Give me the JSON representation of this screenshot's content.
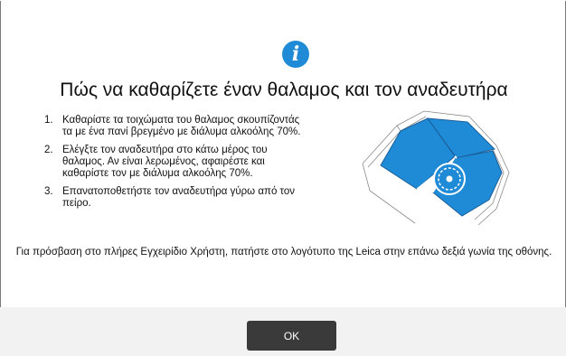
{
  "dialog": {
    "icon": "info-icon",
    "title": "Πώς να καθαρίζετε έναν θαλαμος και τον αναδευτήρα",
    "steps": [
      {
        "number": "1.",
        "text": "Καθαρίστε τα τοιχώματα του θαλαμος σκουπίζοντάς τα με ένα πανί βρεγμένο με διάλυμα αλκοόλης 70%."
      },
      {
        "number": "2.",
        "text": "Ελέγξτε τον αναδευτήρα στο κάτω μέρος του θαλαμος. Αν είναι λερωμένος, αφαιρέστε και καθαρίστε τον με διάλυμα αλκοόλης 70%."
      },
      {
        "number": "3.",
        "text": "Επανατοποθετήστε τον αναδευτήρα γύρω από τον πείρο."
      }
    ],
    "illustration": "chamber-stirrer-diagram",
    "note": "Για πρόσβαση στο πλήρες Εγχειρίδιο Χρήστη, πατήστε στο λογότυπο της Leica στην επάνω δεξιά γωνία της οθόνης.",
    "ok_label": "OK"
  },
  "colors": {
    "accent_blue": "#1f8bd6",
    "button_dark": "#3a3a3a",
    "footer_gray": "#f2f2f2"
  }
}
